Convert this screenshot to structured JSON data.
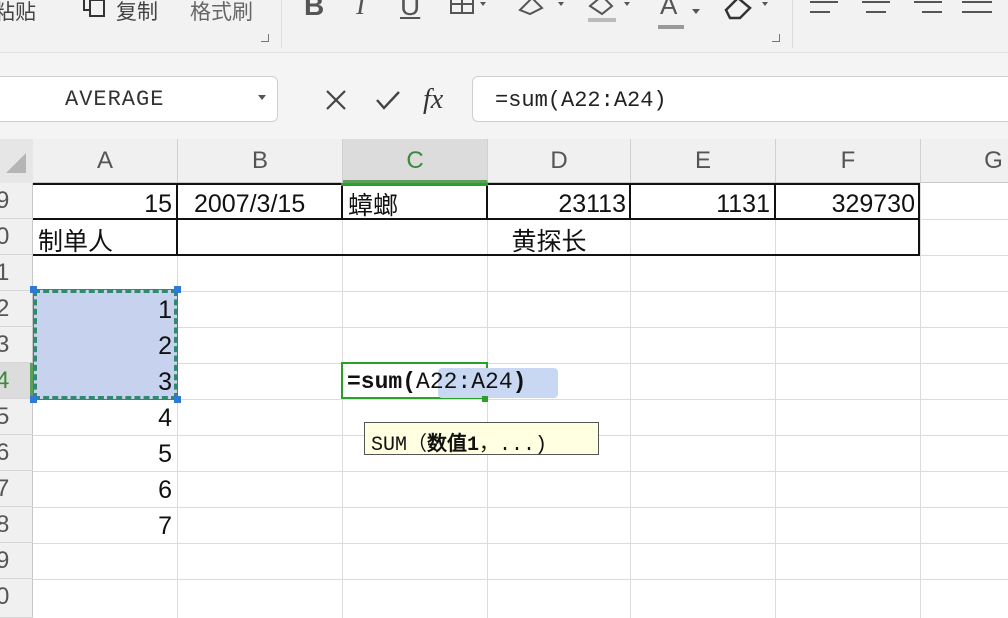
{
  "ribbon": {
    "paste_label": "粘贴",
    "copy_label": "复制",
    "format_painter_label": "格式刷",
    "bold_label": "B",
    "italic_label": "I",
    "underline_label": "U",
    "font_color_label": "A"
  },
  "formula_bar": {
    "name_box": "AVERAGE",
    "fx_label": "fx",
    "formula": "=sum(A22:A24)"
  },
  "columns": [
    "A",
    "B",
    "C",
    "D",
    "E",
    "F",
    "G"
  ],
  "active_column": "C",
  "rows": [
    "9",
    "0",
    "1",
    "2",
    "3",
    "4",
    "5",
    "6",
    "7",
    "8",
    "9",
    "0"
  ],
  "active_row": "4",
  "cells": {
    "r19": {
      "A": "15",
      "B": "2007/3/15",
      "C": "蟑螂",
      "D": "23113",
      "E": "1131",
      "F": "329730"
    },
    "r20": {
      "A": "制单人",
      "merged": "黄探长"
    },
    "a22": "1",
    "a23": "2",
    "a24": "3",
    "a25": "4",
    "a26": "5",
    "a27": "6",
    "a28": "7"
  },
  "editing": {
    "prefix": "=sum(",
    "ref": "A22:A24",
    "suffix": ")"
  },
  "tooltip": {
    "func": "SUM",
    "open": "（",
    "arg": "数值1",
    "rest": "，...)"
  },
  "colors": {
    "selection_fill": "#c7d3ee",
    "marquee": "#2f8a6f",
    "active_border": "#2aa02a",
    "tooltip_bg": "#ffffe1"
  }
}
